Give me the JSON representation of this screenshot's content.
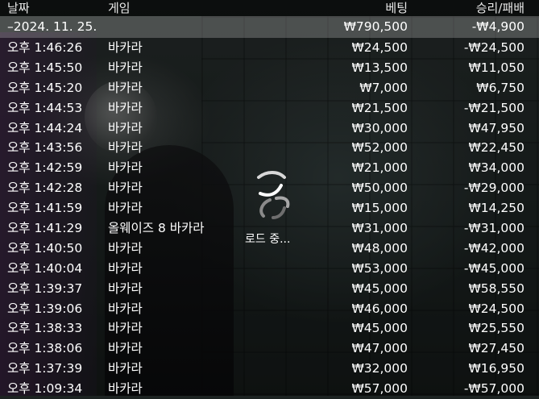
{
  "header": {
    "date": "날짜",
    "game": "게임",
    "bet": "베팅",
    "result": "승리/패배"
  },
  "summary": {
    "date": "–2024. 11. 25.",
    "bet": "₩790,500",
    "result": "-₩4,900"
  },
  "rows": [
    {
      "time": "오후 1:46:26",
      "game": "바카라",
      "bet": "₩24,500",
      "result": "-₩24,500"
    },
    {
      "time": "오후 1:45:50",
      "game": "바카라",
      "bet": "₩13,500",
      "result": "₩11,050"
    },
    {
      "time": "오후 1:45:20",
      "game": "바카라",
      "bet": "₩7,000",
      "result": "₩6,750"
    },
    {
      "time": "오후 1:44:53",
      "game": "바카라",
      "bet": "₩21,500",
      "result": "-₩21,500"
    },
    {
      "time": "오후 1:44:24",
      "game": "바카라",
      "bet": "₩30,000",
      "result": "₩47,950"
    },
    {
      "time": "오후 1:43:56",
      "game": "바카라",
      "bet": "₩52,000",
      "result": "₩22,450"
    },
    {
      "time": "오후 1:42:59",
      "game": "바카라",
      "bet": "₩21,000",
      "result": "₩34,000"
    },
    {
      "time": "오후 1:42:28",
      "game": "바카라",
      "bet": "₩50,000",
      "result": "-₩29,000"
    },
    {
      "time": "오후 1:41:59",
      "game": "바카라",
      "bet": "₩15,000",
      "result": "₩14,250"
    },
    {
      "time": "오후 1:41:29",
      "game": "올웨이즈 8 바카라",
      "bet": "₩31,000",
      "result": "-₩31,000"
    },
    {
      "time": "오후 1:40:50",
      "game": "바카라",
      "bet": "₩48,000",
      "result": "-₩42,000"
    },
    {
      "time": "오후 1:40:04",
      "game": "바카라",
      "bet": "₩53,000",
      "result": "-₩45,000"
    },
    {
      "time": "오후 1:39:37",
      "game": "바카라",
      "bet": "₩45,000",
      "result": "₩58,550"
    },
    {
      "time": "오후 1:39:06",
      "game": "바카라",
      "bet": "₩46,000",
      "result": "₩24,500"
    },
    {
      "time": "오후 1:38:33",
      "game": "바카라",
      "bet": "₩45,000",
      "result": "₩25,550"
    },
    {
      "time": "오후 1:38:06",
      "game": "바카라",
      "bet": "₩47,000",
      "result": "₩27,450"
    },
    {
      "time": "오후 1:37:39",
      "game": "바카라",
      "bet": "₩32,000",
      "result": "₩16,950"
    },
    {
      "time": "오후 1:09:34",
      "game": "바카라",
      "bet": "₩57,000",
      "result": "-₩57,000"
    }
  ],
  "loading": {
    "text": "로드 중...",
    "icon": "loading-spinner-icon"
  }
}
